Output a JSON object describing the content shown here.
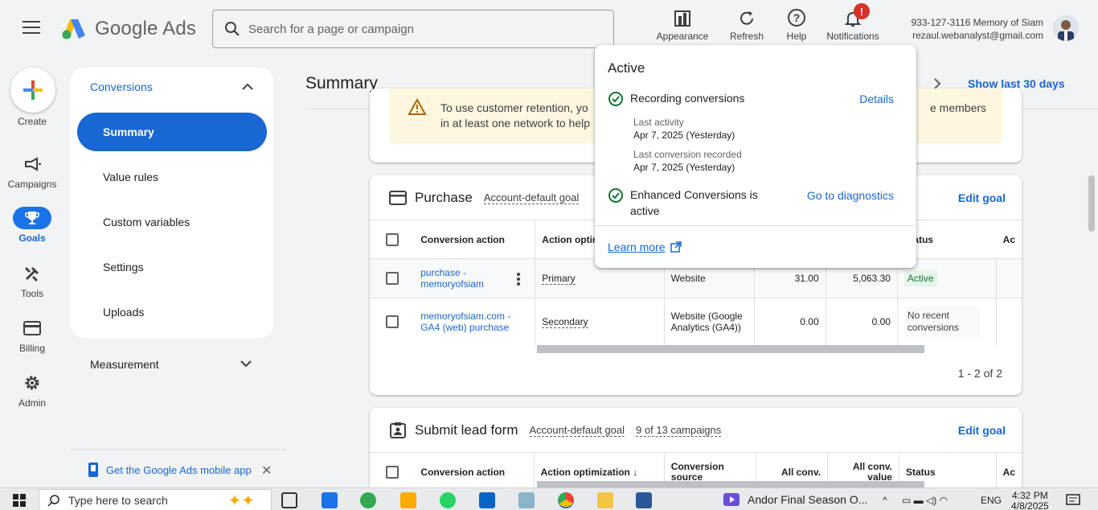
{
  "header": {
    "app_name": "Google Ads",
    "search_placeholder": "Search for a page or campaign",
    "tools": [
      {
        "label": "Appearance"
      },
      {
        "label": "Refresh"
      },
      {
        "label": "Help"
      },
      {
        "label": "Notifications",
        "badge": "!"
      }
    ],
    "account_line1": "933-127-3116 Memory of Siam",
    "account_line2": "rezaul.webanalyst@gmail.com"
  },
  "rail": {
    "create": "Create",
    "campaigns": "Campaigns",
    "goals": "Goals",
    "tools": "Tools",
    "billing": "Billing",
    "admin": "Admin"
  },
  "sidenav": {
    "section": "Conversions",
    "items": [
      "Summary",
      "Value rules",
      "Custom variables",
      "Settings",
      "Uploads"
    ],
    "measurement": "Measurement",
    "mobile_app": "Get the Google Ads mobile app"
  },
  "main": {
    "title": "Summary",
    "date_range": "Show last 30 days",
    "warning": {
      "line1": "To use customer retention, yo",
      "line2": "in at least one network to help",
      "line1_right": "e members"
    },
    "purchase": {
      "title": "Purchase",
      "meta1": "Account-default goal",
      "edit": "Edit goal",
      "columns": [
        "Conversion action",
        "Action optim",
        "",
        "",
        "",
        "Status",
        "Ac"
      ],
      "rows": [
        {
          "name": "purchase - memoryofsiam",
          "optimization": "Primary",
          "source": "Website",
          "all_conv": "31.00",
          "all_value": "5,063.30",
          "status": "Active"
        },
        {
          "name": "memoryofsiam.com - GA4 (web) purchase",
          "optimization": "Secondary",
          "source": "Website (Google Analytics (GA4))",
          "all_conv": "0.00",
          "all_value": "0.00",
          "status": "No recent conversions"
        }
      ],
      "pager": "1 - 2 of 2"
    },
    "lead": {
      "title": "Submit lead form",
      "meta1": "Account-default goal",
      "meta2": "9 of 13 campaigns",
      "edit": "Edit goal",
      "columns": [
        "Conversion action",
        "Action optimization",
        "Conversion source",
        "All conv.",
        "All conv. value",
        "Status",
        "Ac"
      ]
    }
  },
  "popup": {
    "title": "Active",
    "recording": "Recording conversions",
    "details": "Details",
    "last_activity_label": "Last activity",
    "last_activity_value": "Apr 7, 2025 (Yesterday)",
    "last_conv_label": "Last conversion recorded",
    "last_conv_value": "Apr 7, 2025 (Yesterday)",
    "enhanced_line1": "Enhanced Conversions is",
    "enhanced_line2": "active",
    "diagnostics": "Go to diagnostics",
    "learn_more": "Learn more"
  },
  "taskbar": {
    "search_placeholder": "Type here to search",
    "media": "Andor Final Season O...",
    "lang": "ENG",
    "time": "4:32 PM",
    "date": "4/8/2025"
  },
  "colors": {
    "primary": "#1967d2",
    "active_green": "#137333",
    "warning_bg": "#fef7e0",
    "badge_red": "#d93025"
  }
}
